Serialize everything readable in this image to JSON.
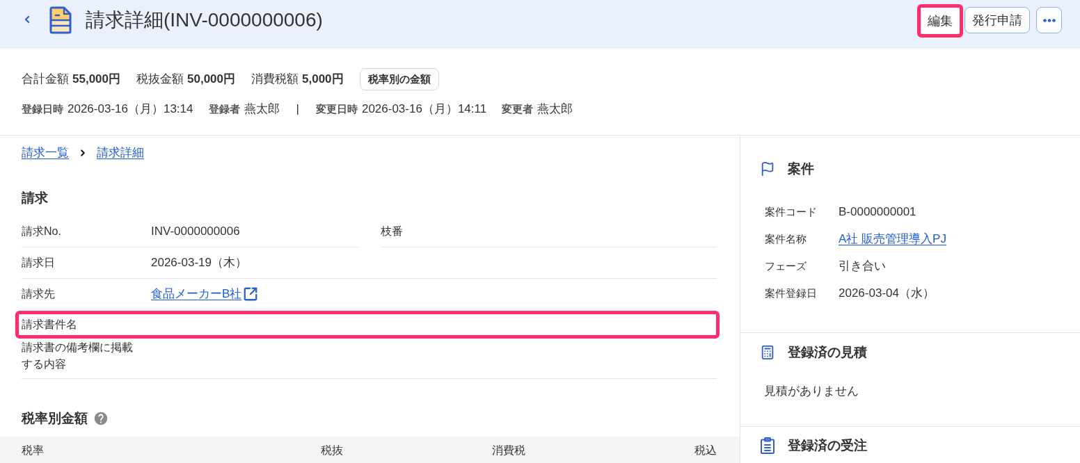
{
  "header": {
    "title": "請求詳細(INV-0000000006)",
    "buttons": [
      {
        "label": "編集",
        "highlighted": true
      },
      {
        "label": "発行申請",
        "highlighted": false
      }
    ]
  },
  "summary": {
    "amounts": [
      {
        "label": "合計金額",
        "value": "55,000円"
      },
      {
        "label": "税抜金額",
        "value": "50,000円"
      },
      {
        "label": "消費税額",
        "value": "5,000円"
      }
    ],
    "tax_rate_button": "税率別の金額",
    "audit": {
      "created": [
        {
          "label": "登録日時",
          "value": "2026-03-16（月）13:14"
        },
        {
          "label": "登録者",
          "value": "燕太郎"
        }
      ],
      "separator": "|",
      "updated": [
        {
          "label": "変更日時",
          "value": "2026-03-16（月）14:11"
        },
        {
          "label": "変更者",
          "value": "燕太郎"
        }
      ]
    }
  },
  "breadcrumb": [
    {
      "label": "請求一覧"
    },
    {
      "label": "請求詳細"
    }
  ],
  "invoice": {
    "title": "請求",
    "rows": [
      {
        "highlighted": false,
        "fields": [
          {
            "label": "請求No.",
            "value": "INV-0000000006",
            "kind": "text"
          },
          {
            "label": "枝番"
          }
        ]
      },
      {
        "highlighted": false,
        "fields": [
          {
            "label": "請求日",
            "value": "2026-03-19（木）",
            "kind": "text"
          }
        ]
      },
      {
        "highlighted": false,
        "fields": [
          {
            "label": "請求先",
            "value": "食品メーカーB社",
            "kind": "external_link"
          }
        ]
      },
      {
        "highlighted": true,
        "fields": [
          {
            "label": "請求書件名"
          }
        ]
      },
      {
        "highlighted": false,
        "fields": [
          {
            "label": "請求書の備考欄に掲載する内容"
          }
        ]
      }
    ]
  },
  "tax_breakdown": {
    "title": "税率別金額",
    "columns": [
      "税率",
      "税抜",
      "消費税",
      "税込"
    ]
  },
  "project": {
    "title": "案件",
    "fields": [
      {
        "label": "案件コード",
        "value": "B-0000000001",
        "kind": "text"
      },
      {
        "label": "案件名称",
        "value": "A社 販売管理導入PJ",
        "kind": "link"
      },
      {
        "label": "フェーズ",
        "value": "引き合い",
        "kind": "text"
      },
      {
        "label": "案件登録日",
        "value": "2026-03-04（水）",
        "kind": "text"
      }
    ]
  },
  "estimates": {
    "title": "登録済の見積",
    "empty_message": "見積がありません"
  },
  "orders": {
    "title": "登録済の受注"
  }
}
